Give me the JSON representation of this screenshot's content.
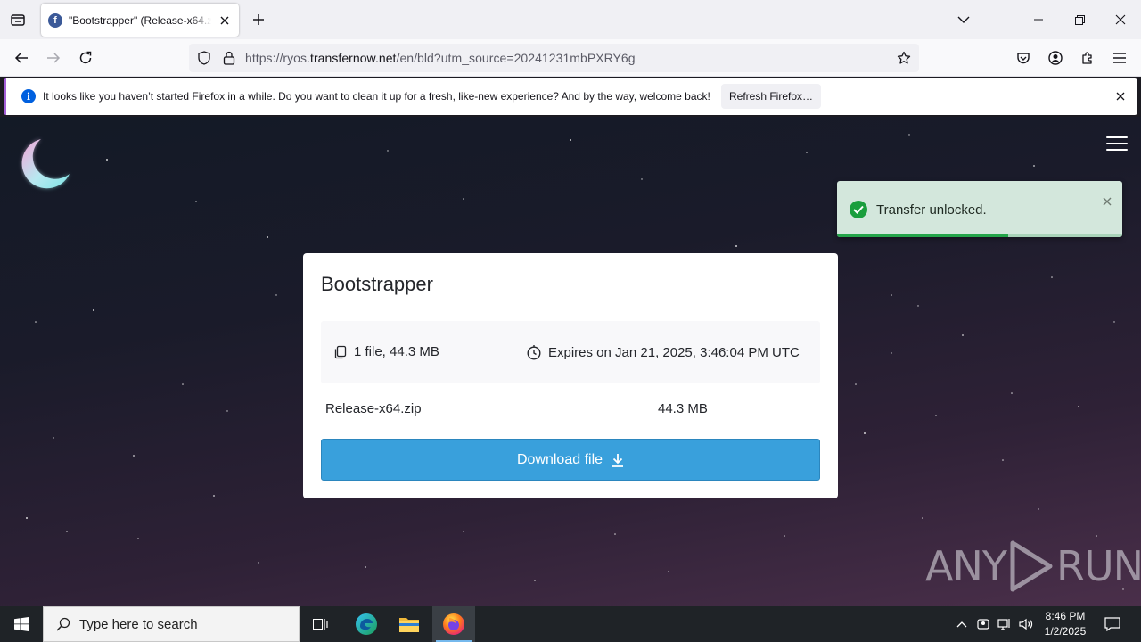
{
  "browser": {
    "tab": {
      "title": "\"Bootstrapper\" (Release-x64.zip)"
    },
    "url": {
      "prefix": "https://ryos.",
      "host": "transfernow.net",
      "path": "/en/bld?utm_source=20241231mbPXRY6g"
    },
    "notification": {
      "message": "It looks like you haven’t started Firefox in a while. Do you want to clean it up for a fresh, like-new experience? And by the way, welcome back!",
      "button_label": "Refresh Firefox…",
      "info_glyph": "i"
    }
  },
  "page": {
    "toast": {
      "message": "Transfer unlocked.",
      "progress": 0.6
    },
    "card": {
      "title": "Bootstrapper",
      "file_count": "1 file, 44.3 MB",
      "expires": "Expires on Jan 21, 2025, 3:46:04 PM UTC",
      "file_name": "Release-x64.zip",
      "file_size": "44.3 MB",
      "download_label": "Download file"
    },
    "watermark": {
      "left": "ANY",
      "right": "RUN"
    }
  },
  "taskbar": {
    "search_placeholder": "Type here to search",
    "time": "8:46 PM",
    "date": "1/2/2025"
  },
  "colors": {
    "accent": "#39a0dc",
    "toast_bg": "#d3e7dc",
    "toast_progress": "#24a54a",
    "notification_accent": "#a45fd8"
  }
}
